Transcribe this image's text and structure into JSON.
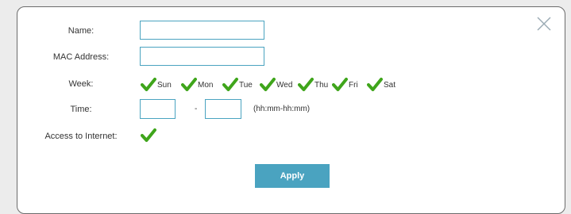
{
  "form": {
    "name_label": "Name:",
    "name_value": "",
    "mac_label": "MAC Address:",
    "mac_value": "",
    "week_label": "Week:",
    "days": [
      {
        "label": "Sun",
        "checked": true
      },
      {
        "label": "Mon",
        "checked": true
      },
      {
        "label": "Tue",
        "checked": true
      },
      {
        "label": "Wed",
        "checked": true
      },
      {
        "label": "Thu",
        "checked": true
      },
      {
        "label": "Fri",
        "checked": true
      },
      {
        "label": "Sat",
        "checked": true
      }
    ],
    "time_label": "Time:",
    "time_start": "",
    "time_separator": "-",
    "time_end": "",
    "time_format_hint": "(hh:mm-hh:mm)",
    "internet_label": "Access to Internet:",
    "internet_checked": true,
    "apply_label": "Apply"
  },
  "icons": {
    "close": "close-icon",
    "check": "checkmark-icon"
  },
  "colors": {
    "accent": "#4aa3c0",
    "check": "#3fa51b",
    "close": "#9aaab3"
  }
}
